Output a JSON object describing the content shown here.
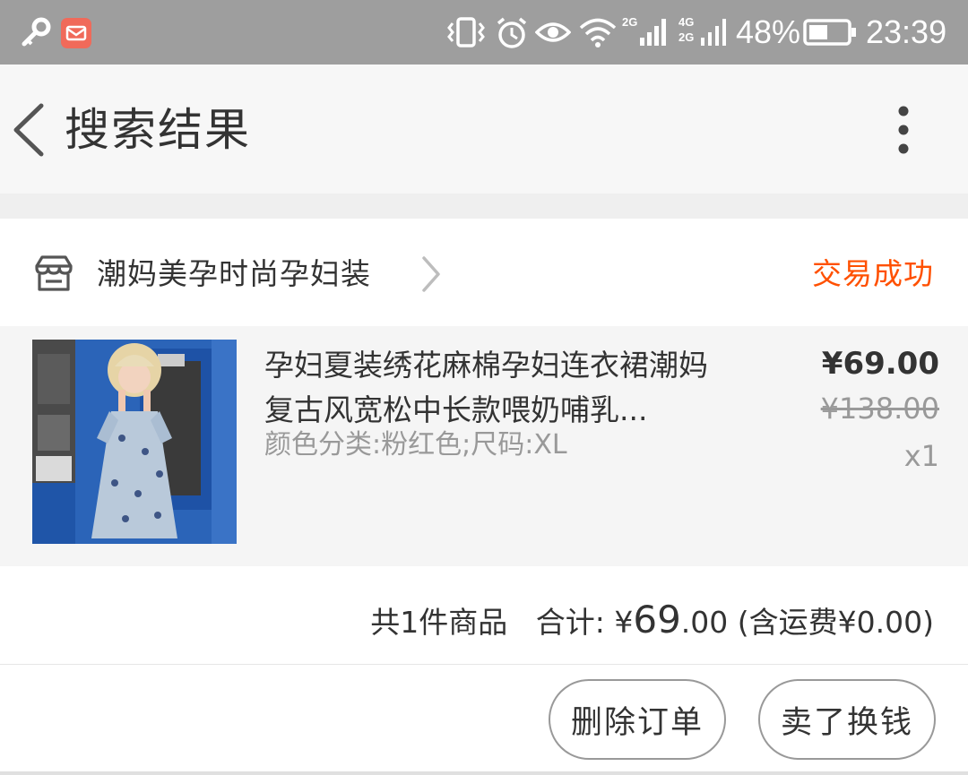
{
  "status_bar": {
    "battery": "48%",
    "time": "23:39",
    "net1": "2G",
    "net2a": "4G",
    "net2b": "2G",
    "icons": [
      "key-icon",
      "mail-app-icon",
      "vibrate-icon",
      "alarm-icon",
      "eye-icon",
      "wifi-icon",
      "signal-icon",
      "battery-icon"
    ]
  },
  "header": {
    "title": "搜索结果",
    "back_icon": "chevron-left-icon",
    "more_icon": "more-vertical-icon"
  },
  "order": {
    "shop_name": "潮妈美孕时尚孕妇装",
    "status": "交易成功",
    "item": {
      "title": "孕妇夏装绣花麻棉孕妇连衣裙潮妈复古风宽松中长款喂奶哺乳...",
      "sku": "颜色分类:粉红色;尺码:XL",
      "price": "¥69.00",
      "original_price": "¥138.00",
      "quantity": "x1"
    },
    "summary": {
      "count_text": "共1件商品",
      "total_label": "合计: ",
      "currency": "¥",
      "total_int": "69",
      "total_dec": ".00",
      "shipping": " (含运费¥0.00)"
    },
    "buttons": {
      "delete": "删除订单",
      "resell": "卖了换钱"
    }
  },
  "colors": {
    "accent": "#ff5000",
    "status_bar": "#9e9e9e",
    "item_bg": "#f5f5f5"
  }
}
